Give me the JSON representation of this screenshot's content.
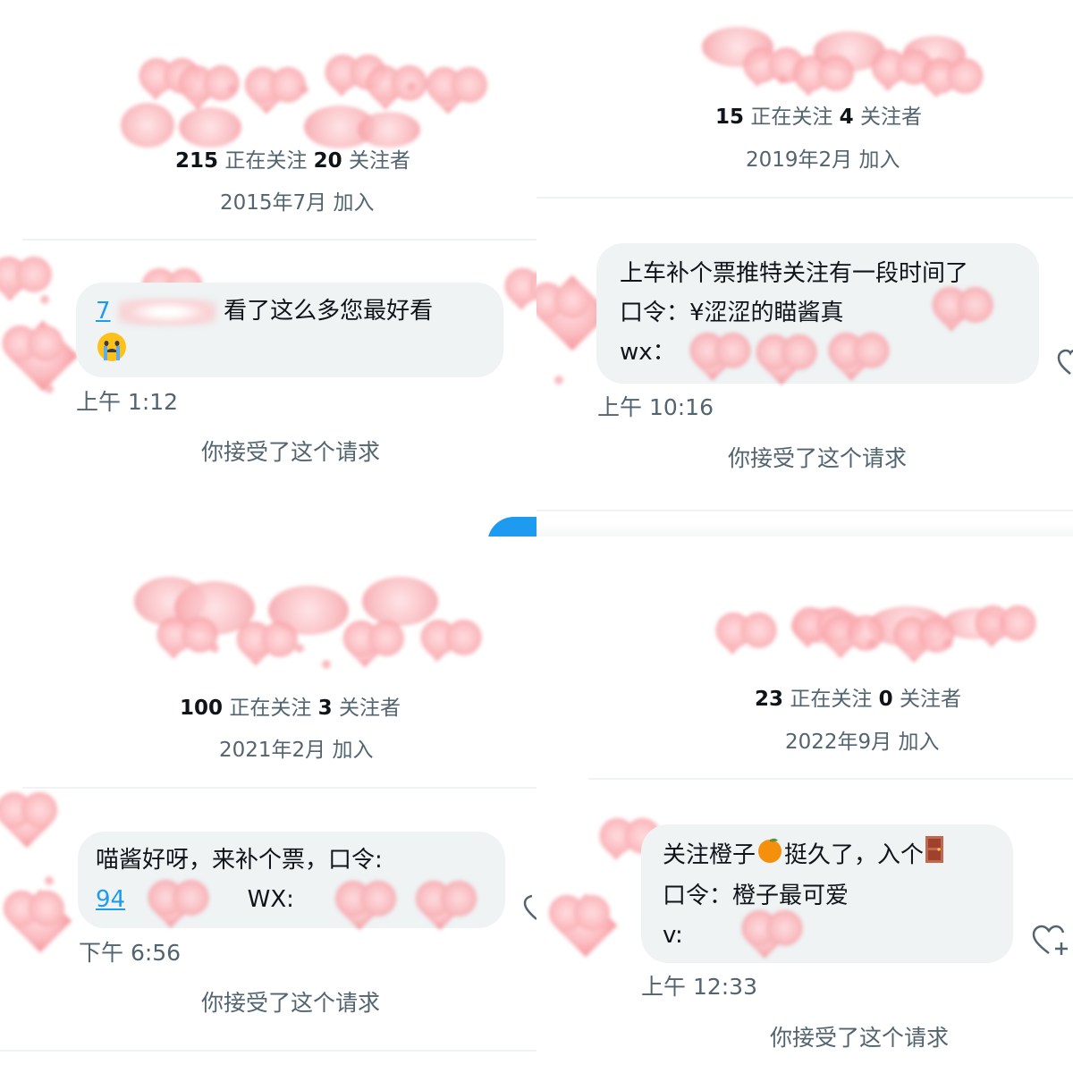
{
  "panels": [
    {
      "following_count": "215",
      "following_label": "正在关注",
      "followers_count": "20",
      "followers_label": "关注者",
      "joined": "2015年7月 加入",
      "message": {
        "line1_prefix": "7",
        "line1_text": "看了这么多您最好看",
        "line2_emoji": "crying-face-icon"
      },
      "time": "上午 1:12",
      "accepted": "你接受了这个请求"
    },
    {
      "following_count": "15",
      "following_label": "正在关注",
      "followers_count": "4",
      "followers_label": "关注者",
      "joined": "2019年2月 加入",
      "message": {
        "line1": "上车补个票推特关注有一段时间了",
        "line2": "口令：¥涩涩的瞄酱真",
        "line3": "wx："
      },
      "time": "上午 10:16",
      "accepted": "你接受了这个请求"
    },
    {
      "following_count": "100",
      "following_label": "正在关注",
      "followers_count": "3",
      "followers_label": "关注者",
      "joined": "2021年2月 加入",
      "message": {
        "line1": "喵酱好呀，来补个票，口令:",
        "line2_link": "94",
        "line2_text": "WX:"
      },
      "time": "下午 6:56",
      "accepted": "你接受了这个请求"
    },
    {
      "following_count": "23",
      "following_label": "正在关注",
      "followers_count": "0",
      "followers_label": "关注者",
      "joined": "2022年9月 加入",
      "message": {
        "line1_a": "关注橙子",
        "line1_emoji": "orange-icon",
        "line1_b": "挺久了，入个",
        "line1_emoji2": "door-icon",
        "line2": "口令：橙子最可爱",
        "line3": "v:"
      },
      "time": "上午 12:33",
      "accepted": "你接受了这个请求"
    }
  ],
  "colors": {
    "link": "#1d9bf0",
    "bubble": "#eff3f4",
    "secondary_text": "#536471",
    "heart_pink": "#f4858c"
  }
}
